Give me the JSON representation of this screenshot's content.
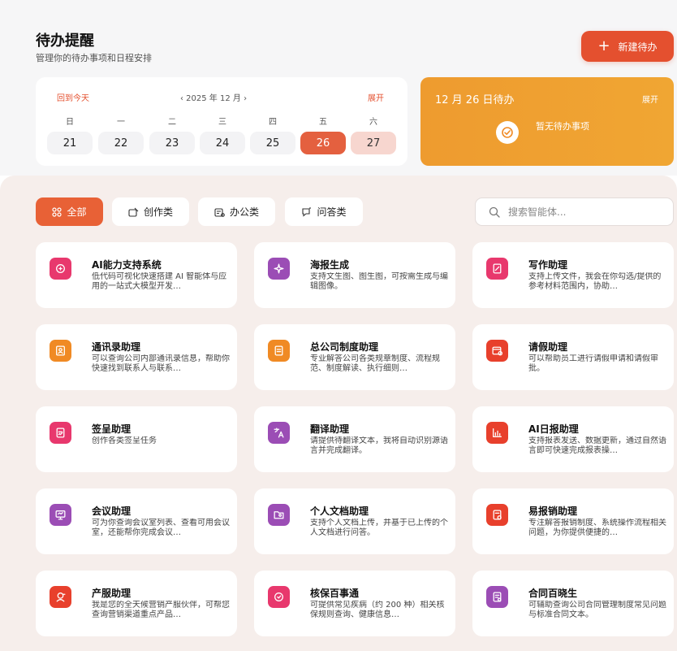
{
  "header": {
    "title": "待办提醒",
    "subtitle": "管理你的待办事项和日程安排",
    "new_button_label": "新建待办"
  },
  "calendar": {
    "today_label": "回到今天",
    "month_label": "‹ 2025 年 12 月 ›",
    "expand_label": "展开",
    "weekdays": [
      "日",
      "一",
      "二",
      "三",
      "四",
      "五",
      "六"
    ],
    "days": [
      "21",
      "22",
      "23",
      "24",
      "25",
      "26",
      "27"
    ],
    "selected_day": "26"
  },
  "todo_panel": {
    "title": "12 月 26 日待办",
    "expand_label": "展开",
    "empty_text": "暂无待办事项"
  },
  "tabs": [
    {
      "label": "全部",
      "icon": "grid-icon",
      "active": true
    },
    {
      "label": "创作类",
      "icon": "create-icon",
      "active": false
    },
    {
      "label": "办公类",
      "icon": "office-icon",
      "active": false
    },
    {
      "label": "问答类",
      "icon": "qa-icon",
      "active": false
    }
  ],
  "search": {
    "placeholder": "搜索智能体..."
  },
  "cards": [
    {
      "title": "AI能力支持系统",
      "desc": "低代码可视化快速搭建 AI 智能体与应用的一站式大模型开发…",
      "color": "#e8386d",
      "icon": "ai-system-icon"
    },
    {
      "title": "海报生成",
      "desc": "支持文生图、图生图，可按需生成与编辑图像。",
      "color": "#9b4db5",
      "icon": "sparkle-icon"
    },
    {
      "title": "写作助理",
      "desc": "支持上传文件，我会在你勾选/提供的参考材料范围内，协助…",
      "color": "#e8386d",
      "icon": "pen-doc-icon"
    },
    {
      "title": "通讯录助理",
      "desc": "可以查询公司内部通讯录信息，帮助你快速找到联系人与联系…",
      "color": "#f08a24",
      "icon": "contacts-icon"
    },
    {
      "title": "总公司制度助理",
      "desc": "专业解答公司各类规章制度、流程规范、制度解读、执行细则…",
      "color": "#f08a24",
      "icon": "rules-doc-icon"
    },
    {
      "title": "请假助理",
      "desc": "可以帮助员工进行请假申请和请假审批。",
      "color": "#e8402c",
      "icon": "leave-icon"
    },
    {
      "title": "签呈助理",
      "desc": "创作各类签呈任务",
      "color": "#e8386d",
      "icon": "sign-doc-icon"
    },
    {
      "title": "翻译助理",
      "desc": "请提供待翻译文本，我将自动识别源语言并完成翻译。",
      "color": "#9b4db5",
      "icon": "translate-icon"
    },
    {
      "title": "AI日报助理",
      "desc": "支持报表发送、数据更新，通过自然语言即可快速完成报表操…",
      "color": "#e8402c",
      "icon": "chart-icon"
    },
    {
      "title": "会议助理",
      "desc": "可为你查询会议室列表、查看可用会议室，还能帮你完成会议…",
      "color": "#9b4db5",
      "icon": "meeting-icon"
    },
    {
      "title": "个人文档助理",
      "desc": "支持个人文档上传，并基于已上传的个人文档进行问答。",
      "color": "#9b4db5",
      "icon": "folder-user-icon"
    },
    {
      "title": "易报销助理",
      "desc": "专注解答报销制度、系统操作流程相关问题，为你提供便捷的…",
      "color": "#e8402c",
      "icon": "reimburse-icon"
    },
    {
      "title": "产服助理",
      "desc": "我是您的全天候营销产服伙伴，可帮您查询营销渠道重点产品…",
      "color": "#e8402c",
      "icon": "service-icon"
    },
    {
      "title": "核保百事通",
      "desc": "可提供常见疾病（约 200 种）相关核保规则查询、健康信息…",
      "color": "#e8386d",
      "icon": "underwrite-icon"
    },
    {
      "title": "合同百晓生",
      "desc": "可辅助查询公司合同管理制度常见问题与标准合同文本。",
      "color": "#9b4db5",
      "icon": "contract-icon"
    }
  ]
}
